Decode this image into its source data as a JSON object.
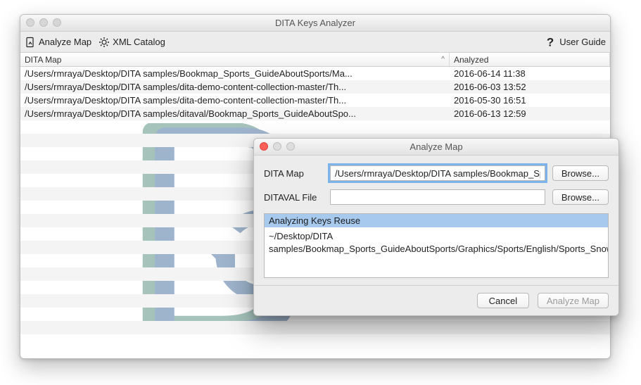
{
  "main_window": {
    "title": "DITA Keys Analyzer",
    "toolbar": {
      "analyze_map": "Analyze Map",
      "xml_catalog": "XML Catalog",
      "user_guide": "User Guide"
    },
    "columns": {
      "map": "DITA Map",
      "analyzed": "Analyzed",
      "sort_indicator": "^"
    },
    "rows": [
      {
        "map": "/Users/rmraya/Desktop/DITA samples/Bookmap_Sports_GuideAboutSports/Ma...",
        "analyzed": "2016-06-14 11:38"
      },
      {
        "map": "/Users/rmraya/Desktop/DITA samples/dita-demo-content-collection-master/Th...",
        "analyzed": "2016-06-03 13:52"
      },
      {
        "map": "/Users/rmraya/Desktop/DITA samples/dita-demo-content-collection-master/Th...",
        "analyzed": "2016-05-30 16:51"
      },
      {
        "map": "/Users/rmraya/Desktop/DITA samples/ditaval/Bookmap_Sports_GuideAboutSpo...",
        "analyzed": "2016-06-13 12:59"
      }
    ]
  },
  "dialog": {
    "title": "Analyze Map",
    "labels": {
      "dita_map": "DITA Map",
      "ditaval": "DITAVAL File"
    },
    "values": {
      "dita_map": "/Users/rmraya/Desktop/DITA samples/Bookmap_Spo",
      "ditaval": ""
    },
    "buttons": {
      "browse": "Browse...",
      "cancel": "Cancel",
      "analyze": "Analyze Map"
    },
    "status": {
      "header": "Analyzing Keys Reuse",
      "body": "~/Desktop/DITA samples/Bookmap_Sports_GuideAboutSports/Graphics/Sports/English/Sports_SnowKiting_SVG.svg"
    }
  }
}
